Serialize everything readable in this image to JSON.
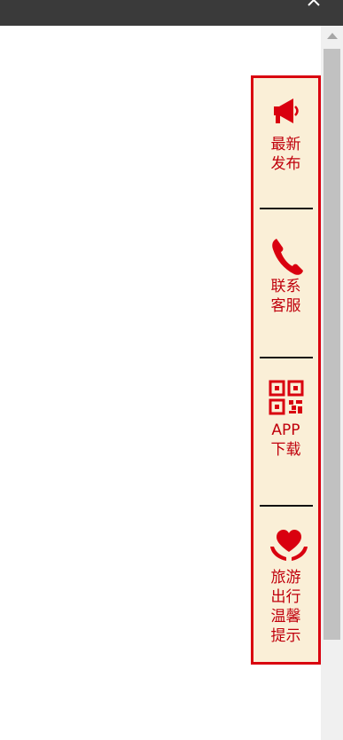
{
  "colors": {
    "accent": "#d9000f",
    "panel_bg": "#faefd7",
    "label": "#c0000c",
    "titlebar": "#3a3a3a",
    "scroll_track": "#f0f0f0",
    "scroll_thumb": "#c1c1c1"
  },
  "sidebar": {
    "items": [
      {
        "icon": "megaphone-icon",
        "label_lines": [
          "最新",
          "发布"
        ]
      },
      {
        "icon": "phone-icon",
        "label_lines": [
          "联系",
          "客服"
        ]
      },
      {
        "icon": "qr-code-icon",
        "label_lines": [
          "APP",
          "下载"
        ]
      },
      {
        "icon": "heart-in-hands-icon",
        "label_lines": [
          "旅游",
          "出行",
          "温馨",
          "提示"
        ]
      }
    ]
  }
}
